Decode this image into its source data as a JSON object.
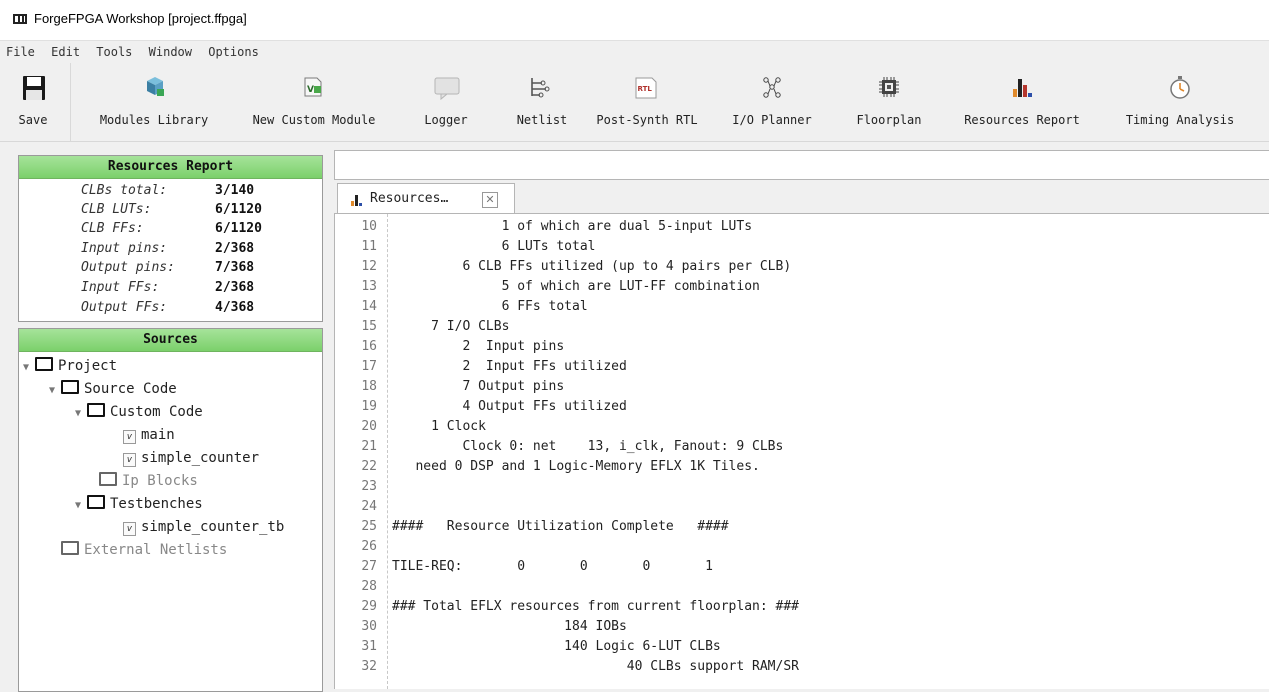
{
  "window": {
    "title": "ForgeFPGA Workshop [project.ffpga]"
  },
  "menu": [
    "File",
    "Edit",
    "Tools",
    "Window",
    "Options"
  ],
  "toolbar": {
    "save": "Save",
    "modules_library": "Modules Library",
    "new_custom_module": "New Custom Module",
    "logger": "Logger",
    "netlist": "Netlist",
    "post_synth_rtl": "Post-Synth RTL",
    "io_planner": "I/O Planner",
    "floorplan": "Floorplan",
    "resources_report": "Resources Report",
    "timing_analysis": "Timing Analysis",
    "icons": {
      "save": "floppy-disk-icon",
      "modules_library": "cubes-icon",
      "new_custom_module": "verilog-file-icon",
      "logger": "speech-bubble-icon",
      "netlist": "netlist-icon",
      "post_synth_rtl": "rtl-document-icon",
      "io_planner": "network-nodes-icon",
      "floorplan": "chip-icon",
      "resources_report": "bar-chart-icon",
      "timing_analysis": "stopwatch-icon"
    }
  },
  "resources_panel": {
    "title": "Resources Report",
    "rows": [
      {
        "key": "CLBs total:",
        "value": "3/140"
      },
      {
        "key": "CLB LUTs:",
        "value": "6/1120"
      },
      {
        "key": "CLB FFs:",
        "value": "6/1120"
      },
      {
        "key": "Input pins:",
        "value": "2/368"
      },
      {
        "key": "Output pins:",
        "value": "7/368"
      },
      {
        "key": "Input FFs:",
        "value": "2/368"
      },
      {
        "key": "Output FFs:",
        "value": "4/368"
      }
    ]
  },
  "sources_panel": {
    "title": "Sources",
    "tree": {
      "project": "Project",
      "source_code": "Source Code",
      "custom_code": "Custom Code",
      "main": "main",
      "simple_counter": "simple_counter",
      "ip_blocks": "Ip Blocks",
      "testbenches": "Testbenches",
      "simple_counter_tb": "simple_counter_tb",
      "external_netlists": "External Netlists"
    },
    "file_badge": "v"
  },
  "editor": {
    "tab_label": "Resources…",
    "tab_close": "✕",
    "lines": [
      {
        "n": "10",
        "t": "              1 of which are dual 5-input LUTs"
      },
      {
        "n": "11",
        "t": "              6 LUTs total"
      },
      {
        "n": "12",
        "t": "         6 CLB FFs utilized (up to 4 pairs per CLB)"
      },
      {
        "n": "13",
        "t": "              5 of which are LUT-FF combination"
      },
      {
        "n": "14",
        "t": "              6 FFs total"
      },
      {
        "n": "15",
        "t": "     7 I/O CLBs"
      },
      {
        "n": "16",
        "t": "         2  Input pins"
      },
      {
        "n": "17",
        "t": "         2  Input FFs utilized"
      },
      {
        "n": "18",
        "t": "         7 Output pins"
      },
      {
        "n": "19",
        "t": "         4 Output FFs utilized"
      },
      {
        "n": "20",
        "t": "     1 Clock"
      },
      {
        "n": "21",
        "t": "         Clock 0: net    13, i_clk, Fanout: 9 CLBs"
      },
      {
        "n": "22",
        "t": "   need 0 DSP and 1 Logic-Memory EFLX 1K Tiles."
      },
      {
        "n": "23",
        "t": ""
      },
      {
        "n": "24",
        "t": ""
      },
      {
        "n": "25",
        "t": "####   Resource Utilization Complete   ####"
      },
      {
        "n": "26",
        "t": ""
      },
      {
        "n": "27",
        "t": "TILE-REQ:       0       0       0       1"
      },
      {
        "n": "28",
        "t": ""
      },
      {
        "n": "29",
        "t": "### Total EFLX resources from current floorplan: ###"
      },
      {
        "n": "30",
        "t": "                      184 IOBs"
      },
      {
        "n": "31",
        "t": "                      140 Logic 6-LUT CLBs"
      },
      {
        "n": "32",
        "t": "                              40 CLBs support RAM/SR"
      }
    ]
  }
}
